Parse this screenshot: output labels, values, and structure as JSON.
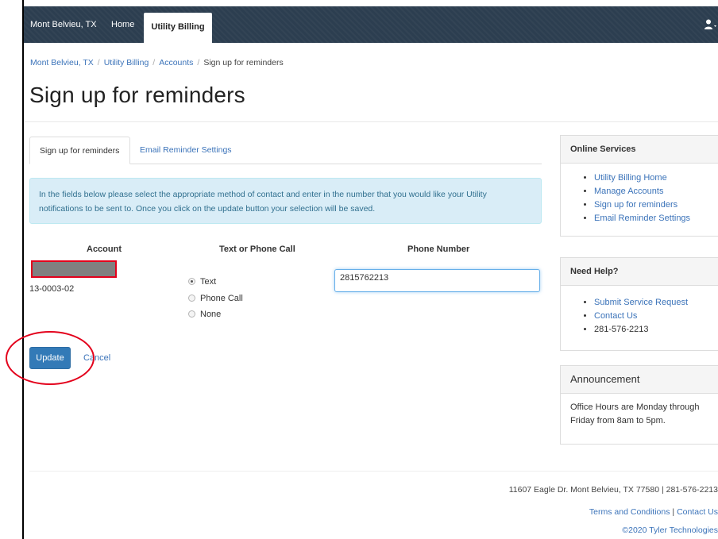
{
  "navbar": {
    "brand": "Mont Belvieu, TX",
    "home": "Home",
    "active": "Utility Billing",
    "user_icon": "user-icon"
  },
  "breadcrumb": {
    "items": [
      "Mont Belvieu, TX",
      "Utility Billing",
      "Accounts"
    ],
    "current": "Sign up for reminders",
    "separator": "/"
  },
  "page_title": "Sign up for reminders",
  "tabs": [
    {
      "label": "Sign up for reminders",
      "active": true
    },
    {
      "label": "Email Reminder Settings",
      "active": false
    }
  ],
  "info_text": "In the fields below please select the appropriate method of contact and enter in the number that you would like your Utility notifications to be sent to. Once you click on the update button your selection will be saved.",
  "table": {
    "headers": [
      "Account",
      "Text or Phone Call",
      "Phone Number"
    ],
    "account_number": "13-0003-02",
    "radio_options": [
      {
        "label": "Text",
        "checked": true
      },
      {
        "label": "Phone Call",
        "checked": false
      },
      {
        "label": "None",
        "checked": false
      }
    ],
    "phone_value": "2815762213"
  },
  "actions": {
    "update": "Update",
    "cancel": "Cancel"
  },
  "sidebar": {
    "online_services": {
      "title": "Online Services",
      "links": [
        "Utility Billing Home",
        "Manage Accounts",
        "Sign up for reminders",
        "Email Reminder Settings"
      ]
    },
    "need_help": {
      "title": "Need Help?",
      "links": [
        "Submit Service Request",
        "Contact Us"
      ],
      "phone": "281-576-2213"
    },
    "announcement": {
      "title": "Announcement",
      "body": "Office Hours are Monday through Friday from 8am to 5pm."
    }
  },
  "footer": {
    "address": "11607 Eagle Dr. Mont Belvieu, TX 77580 | 281-576-2213",
    "terms": "Terms and Conditions",
    "pipe": "|",
    "contact": "Contact Us",
    "copyright": "©2020 Tyler Technologies"
  },
  "colors": {
    "navbar": "#2c3e50",
    "link": "#3b73b9",
    "primary": "#337ab7",
    "info_bg": "#d9edf7",
    "annotation": "#e3001b"
  }
}
